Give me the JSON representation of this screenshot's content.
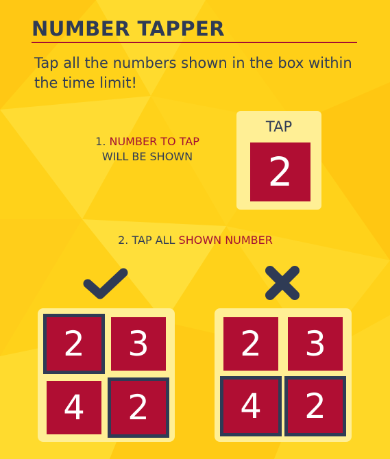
{
  "colors": {
    "background": "#ffd21a",
    "panel": "#ffef95",
    "tile": "#b00e33",
    "text": "#2f3b55",
    "accent": "#a30f33"
  },
  "header": {
    "title": "NUMBER TAPPER",
    "instruction": "Tap all the numbers shown in the box within the time limit!"
  },
  "step1": {
    "prefix": "1. ",
    "highlight": "NUMBER TO TAP",
    "rest": "WILL BE SHOWN"
  },
  "tap_box": {
    "label": "TAP",
    "number": "2"
  },
  "step2": {
    "prefix": "2. TAP ALL ",
    "highlight": "SHOWN NUMBER"
  },
  "correct_example": {
    "icon": "check-icon",
    "cells": [
      "2",
      "3",
      "4",
      "2"
    ],
    "selected": [
      true,
      false,
      false,
      true
    ]
  },
  "wrong_example": {
    "icon": "cross-icon",
    "cells": [
      "2",
      "3",
      "4",
      "2"
    ],
    "selected": [
      false,
      false,
      true,
      true
    ]
  }
}
